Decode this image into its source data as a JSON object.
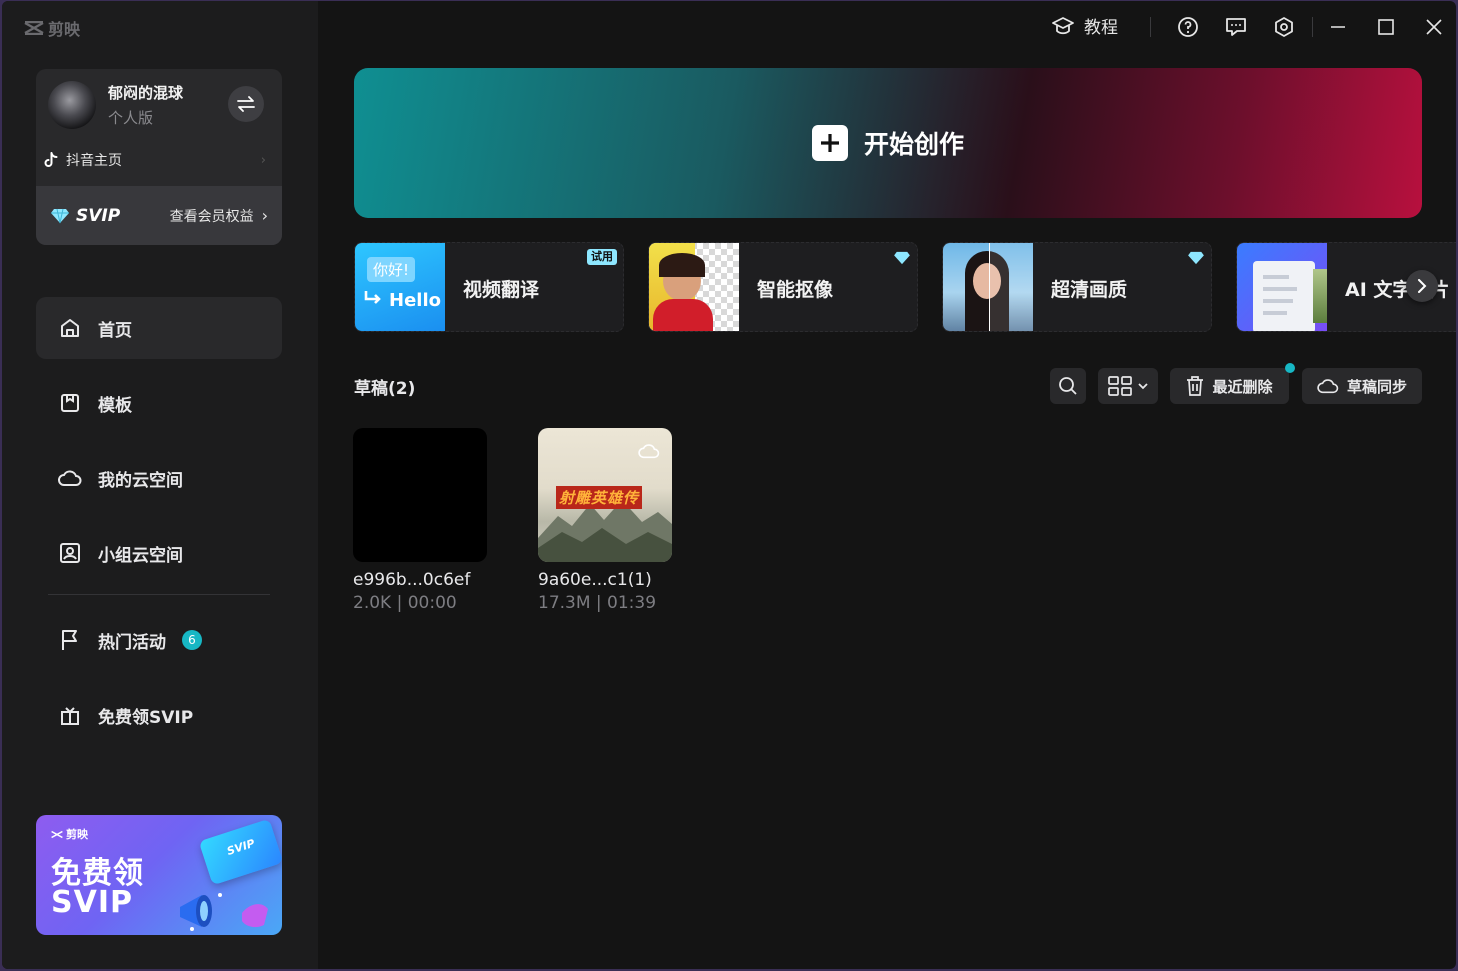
{
  "app": {
    "name": "剪映"
  },
  "account": {
    "name": "郁闷的混球",
    "plan": "个人版",
    "douyin_link": "抖音主页",
    "svip_label": "SVIP",
    "svip_benefits": "查看会员权益"
  },
  "nav": [
    {
      "label": "首页",
      "active": true
    },
    {
      "label": "模板"
    },
    {
      "label": "我的云空间"
    },
    {
      "label": "小组云空间"
    },
    {
      "label": "热门活动",
      "badge": "6"
    },
    {
      "label": "免费领SVIP"
    }
  ],
  "promo": {
    "logo": "剪映",
    "line1": "免费领",
    "line2": "SVIP",
    "card_text": "SVIP"
  },
  "topbar": {
    "tutorial": "教程"
  },
  "hero": {
    "label": "开始创作"
  },
  "features": [
    {
      "title": "视频翻译",
      "tag": "试用",
      "thumb_text_1": "你好!",
      "thumb_text_2": "Hello"
    },
    {
      "title": "智能抠像",
      "tag_icon": "diamond-icon"
    },
    {
      "title": "超清画质",
      "tag_icon": "diamond-icon"
    },
    {
      "title": "AI 文字成片"
    }
  ],
  "drafts": {
    "title": "草稿(2)",
    "recent_delete": "最近删除",
    "sync": "草稿同步",
    "items": [
      {
        "name": "e996b...0c6ef",
        "meta": "2.0K | 00:00"
      },
      {
        "name": "9a60e...c1(1)",
        "meta": "17.3M | 01:39",
        "thumb_caption": "射雕英雄传"
      }
    ]
  },
  "colors": {
    "accent": "#17b7c4",
    "background": "#141414",
    "sidebar": "#1c1c1d",
    "card": "#29292b"
  }
}
